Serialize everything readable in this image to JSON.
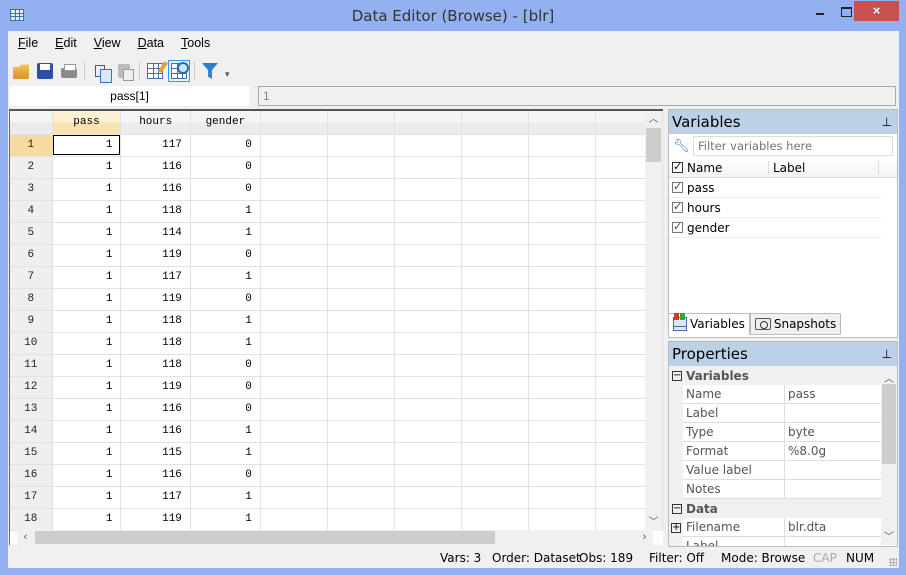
{
  "window": {
    "title": "Data Editor (Browse) - [blr]",
    "controls": {
      "minimize": "minimize-icon",
      "maximize": "maximize-icon",
      "close": "×"
    }
  },
  "menu": [
    {
      "label": "File",
      "mnemonic": "F",
      "rest": "ile"
    },
    {
      "label": "Edit",
      "mnemonic": "E",
      "rest": "dit"
    },
    {
      "label": "View",
      "mnemonic": "V",
      "rest": "iew"
    },
    {
      "label": "Data",
      "mnemonic": "D",
      "rest": "ata"
    },
    {
      "label": "Tools",
      "mnemonic": "T",
      "rest": "ools"
    }
  ],
  "toolbar": {
    "icons": [
      "open-icon",
      "save-icon",
      "print-icon",
      "copy-icon",
      "paste-icon",
      "data-editor-edit-icon",
      "data-editor-browse-icon",
      "filter-icon"
    ],
    "active": "data-editor-browse-icon"
  },
  "cell": {
    "name": "pass[1]",
    "value": "1"
  },
  "grid": {
    "columns": [
      "pass",
      "hours",
      "gender"
    ],
    "empty_columns": 6,
    "selected_column": "pass",
    "selected_row": 1,
    "rows": [
      {
        "n": "1",
        "pass": "1",
        "hours": "117",
        "gender": "0"
      },
      {
        "n": "2",
        "pass": "1",
        "hours": "116",
        "gender": "0"
      },
      {
        "n": "3",
        "pass": "1",
        "hours": "116",
        "gender": "0"
      },
      {
        "n": "4",
        "pass": "1",
        "hours": "118",
        "gender": "1"
      },
      {
        "n": "5",
        "pass": "1",
        "hours": "114",
        "gender": "1"
      },
      {
        "n": "6",
        "pass": "1",
        "hours": "119",
        "gender": "0"
      },
      {
        "n": "7",
        "pass": "1",
        "hours": "117",
        "gender": "1"
      },
      {
        "n": "8",
        "pass": "1",
        "hours": "119",
        "gender": "0"
      },
      {
        "n": "9",
        "pass": "1",
        "hours": "118",
        "gender": "1"
      },
      {
        "n": "10",
        "pass": "1",
        "hours": "118",
        "gender": "1"
      },
      {
        "n": "11",
        "pass": "1",
        "hours": "118",
        "gender": "0"
      },
      {
        "n": "12",
        "pass": "1",
        "hours": "119",
        "gender": "0"
      },
      {
        "n": "13",
        "pass": "1",
        "hours": "116",
        "gender": "0"
      },
      {
        "n": "14",
        "pass": "1",
        "hours": "116",
        "gender": "1"
      },
      {
        "n": "15",
        "pass": "1",
        "hours": "115",
        "gender": "1"
      },
      {
        "n": "16",
        "pass": "1",
        "hours": "116",
        "gender": "0"
      },
      {
        "n": "17",
        "pass": "1",
        "hours": "117",
        "gender": "1"
      },
      {
        "n": "18",
        "pass": "1",
        "hours": "119",
        "gender": "1"
      }
    ]
  },
  "variables_panel": {
    "title": "Variables",
    "filter_placeholder": "Filter variables here",
    "headers": {
      "name": "Name",
      "label": "Label"
    },
    "items": [
      {
        "name": "pass",
        "label": "",
        "checked": true
      },
      {
        "name": "hours",
        "label": "",
        "checked": true
      },
      {
        "name": "gender",
        "label": "",
        "checked": true
      }
    ],
    "tabs": [
      {
        "label": "Variables",
        "active": true
      },
      {
        "label": "Snapshots",
        "active": false
      }
    ]
  },
  "properties_panel": {
    "title": "Properties",
    "groups": [
      {
        "label": "Variables",
        "expanded": true,
        "rows": [
          {
            "name": "Name",
            "value": "pass"
          },
          {
            "name": "Label",
            "value": ""
          },
          {
            "name": "Type",
            "value": "byte"
          },
          {
            "name": "Format",
            "value": "%8.0g"
          },
          {
            "name": "Value label",
            "value": ""
          },
          {
            "name": "Notes",
            "value": ""
          }
        ]
      },
      {
        "label": "Data",
        "expanded": true,
        "rows": [
          {
            "name": "Filename",
            "value": "blr.dta",
            "expandable": true
          },
          {
            "name": "Label",
            "value": ""
          }
        ]
      }
    ]
  },
  "status": {
    "vars": "Vars: 3",
    "order": "Order: Dataset",
    "obs": "Obs: 189",
    "filter": "Filter: Off",
    "mode": "Mode: Browse",
    "cap": "CAP",
    "num": "NUM"
  }
}
